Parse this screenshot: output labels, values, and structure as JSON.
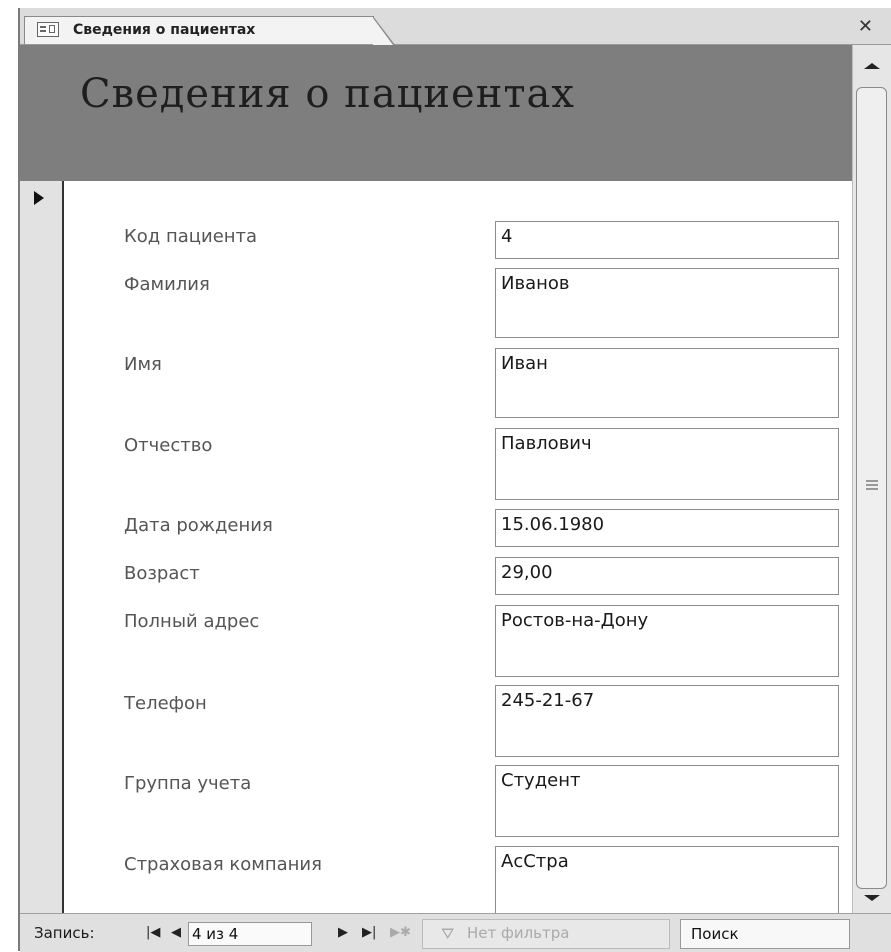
{
  "tab": {
    "title": "Сведения о пациентах"
  },
  "form": {
    "header_title": "Сведения о пациентах",
    "fields": [
      {
        "label": "Код пациента",
        "value": "4"
      },
      {
        "label": "Фамилия",
        "value": "Иванов"
      },
      {
        "label": "Имя",
        "value": "Иван"
      },
      {
        "label": "Отчество",
        "value": "Павлович"
      },
      {
        "label": "Дата рождения",
        "value": "15.06.1980"
      },
      {
        "label": "Возраст",
        "value": "29,00"
      },
      {
        "label": "Полный адрес",
        "value": "Ростов-на-Дону"
      },
      {
        "label": "Телефон",
        "value": "245-21-67"
      },
      {
        "label": "Группа учета",
        "value": "Студент"
      },
      {
        "label": "Страховая компания",
        "value": "АсСтра"
      }
    ]
  },
  "navbar": {
    "record_label": "Запись:",
    "record_position": "4 из 4",
    "filter_label": "Нет фильтра",
    "search_label": "Поиск"
  },
  "icons": {
    "tab_icon": "form-icon",
    "close": "close-icon",
    "record_selector": "current-record-arrow-icon",
    "first": "first-record-icon",
    "prev": "previous-record-icon",
    "next": "next-record-icon",
    "last": "last-record-icon",
    "new": "new-record-icon",
    "filter": "filter-icon"
  }
}
